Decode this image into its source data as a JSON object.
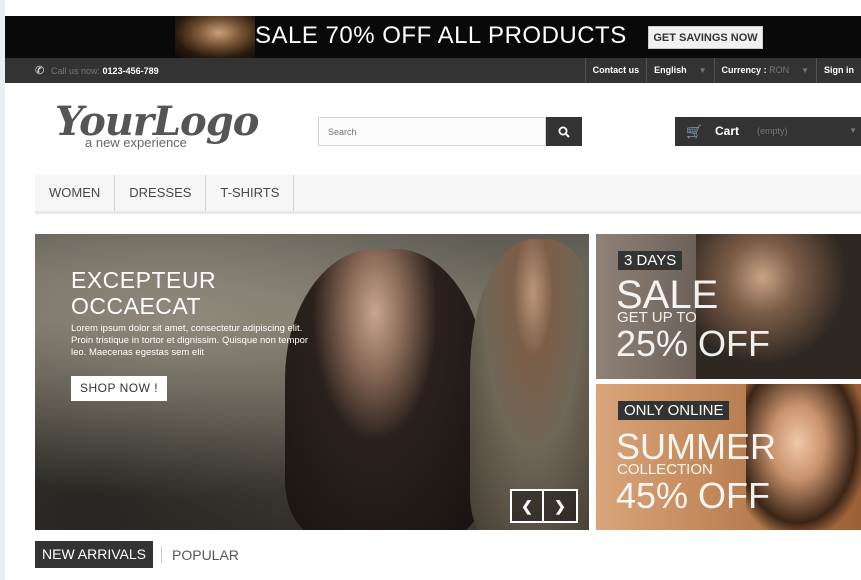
{
  "promo": {
    "headline": "SALE 70% OFF ALL PRODUCTS",
    "cta": "GET SAVINGS NOW"
  },
  "topbar": {
    "call_label": "Call us now:",
    "phone": "0123-456-789",
    "contact": "Contact us",
    "language": "English",
    "currency_label": "Currency :",
    "currency_value": "RON",
    "signin": "Sign in"
  },
  "header": {
    "logo_main": "YourLogo",
    "logo_tagline": "a new experience",
    "search_placeholder": "Search",
    "cart_label": "Cart",
    "cart_status": "(empty)"
  },
  "menu": {
    "items": [
      {
        "label": "WOMEN"
      },
      {
        "label": "DRESSES"
      },
      {
        "label": "T-SHIRTS"
      }
    ]
  },
  "slider": {
    "title_line1": "EXCEPTEUR",
    "title_line2": "OCCAECAT",
    "description": "Lorem ipsum dolor sit amet, consectetur adipiscing elit. Proin tristique in tortor et dignissim. Quisque non tempor leo. Maecenas egestas sem elit",
    "button": "SHOP NOW !"
  },
  "banners": [
    {
      "tag": "3 DAYS",
      "big": "SALE",
      "sub": "GET UP TO",
      "pct": "25% OFF"
    },
    {
      "tag": "ONLY ONLINE",
      "big": "SUMMER",
      "sub": "COLLECTION",
      "pct": "45% OFF"
    }
  ],
  "tabs": {
    "new_arrivals": "NEW ARRIVALS",
    "popular": "POPULAR"
  },
  "colors": {
    "dark": "#333333",
    "promo_bg": "#090909",
    "menu_bg": "#f6f6f6"
  }
}
